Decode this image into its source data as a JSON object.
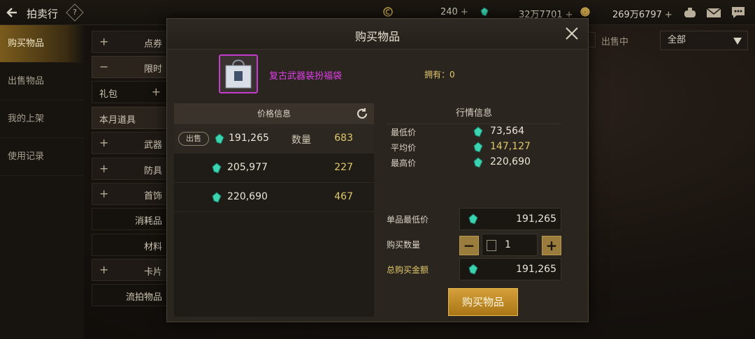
{
  "header": {
    "title": "拍卖行",
    "help_label": "?",
    "currency1": "240",
    "currency2": "32万7701",
    "currency3": "269万6797",
    "plus": "+"
  },
  "leftnav": {
    "items": [
      {
        "label": "购买物品"
      },
      {
        "label": "出售物品"
      },
      {
        "label": "我的上架"
      },
      {
        "label": "使用记录"
      }
    ]
  },
  "categories": [
    {
      "label": "点券",
      "sign": "+"
    },
    {
      "label": "限时",
      "sign": "−"
    },
    {
      "label": "礼包",
      "sign": "+"
    },
    {
      "label": "本月道具",
      "sign": ""
    },
    {
      "label": "武器",
      "sign": "+"
    },
    {
      "label": "防具",
      "sign": "+"
    },
    {
      "label": "首饰",
      "sign": "+"
    },
    {
      "label": "消耗品",
      "sign": ""
    },
    {
      "label": "材料",
      "sign": ""
    },
    {
      "label": "卡片",
      "sign": "+"
    },
    {
      "label": "流拍物品",
      "sign": ""
    }
  ],
  "filters": {
    "selling_label": "出售中",
    "dropdown_value": "全部"
  },
  "modal": {
    "title": "购买物品",
    "item_name": "复古武器装扮福袋",
    "owned_label": "拥有：0",
    "price_header": "价格信息",
    "sell_badge": "出售",
    "qty_label": "数量",
    "listings": [
      {
        "price": "191,265",
        "qty": "683"
      },
      {
        "price": "205,977",
        "qty": "227"
      },
      {
        "price": "220,690",
        "qty": "467"
      }
    ],
    "market_header": "行情信息",
    "market": [
      {
        "label": "最低价",
        "value": "73,564"
      },
      {
        "label": "平均价",
        "value": "147,127"
      },
      {
        "label": "最高价",
        "value": "220,690"
      }
    ],
    "unit_min_label": "单品最低价",
    "unit_min_value": "191,265",
    "buy_qty_label": "购买数量",
    "buy_qty_value": "1",
    "minus": "−",
    "plus": "+",
    "total_label": "总购买金额",
    "total_value": "191,265",
    "buy_button": "购买物品"
  },
  "colors": {
    "accent_gold": "#e0c86a",
    "item_purple": "#e040e8",
    "gem_teal": "#3bd3b0"
  }
}
